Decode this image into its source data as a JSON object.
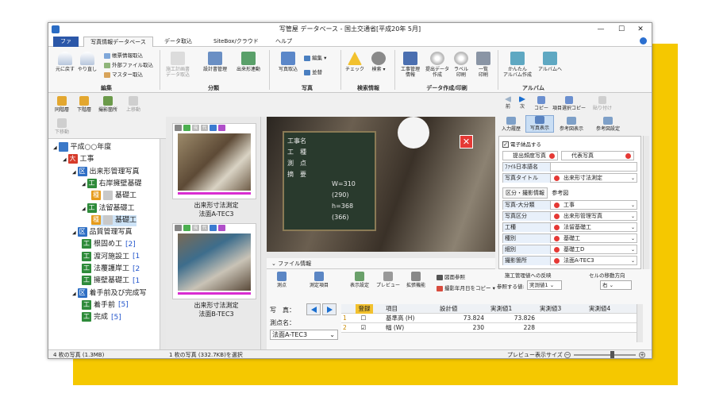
{
  "window": {
    "title": "写管屋 データベース - 国土交通省[平成20年 5月]",
    "minimize": "—",
    "maximize": "☐",
    "close": "✕"
  },
  "menu": {
    "file": "ファイル",
    "tabs": [
      "写真情報データベース",
      "データ取込",
      "SiteBox/クラウド",
      "ヘルプ"
    ]
  },
  "ribbon": {
    "undo": "元に戻す",
    "redo": "やり直し",
    "small_items": [
      "帳票情報取込",
      "外部ファイル取込",
      "マスター取込"
    ],
    "group_edit": "編集",
    "plan_doc": "施工計画書\nデータ取込",
    "design": "設計書管理",
    "output_form": "出来形連動",
    "group_class": "分類",
    "photo_import": "写真取込",
    "edit": "編集",
    "sort": "並替",
    "group_photo": "写真",
    "check": "チェック",
    "search": "検索",
    "group_search": "検索情報",
    "const_info": "工事管理\n情報",
    "submit_data": "提出データ\n作成",
    "label_print": "ラベル\n印刷",
    "list_print": "一覧\n印刷",
    "group_print": "データ作成/印刷",
    "easy_album": "かんたん\nアルバム作成",
    "album": "アルバムへ",
    "group_album": "アルバム"
  },
  "nav_tools": {
    "same_level": "同階層",
    "lower": "下階層",
    "shooting_place": "撮影箇所",
    "up": "上移動",
    "down": "下移動"
  },
  "tree": [
    {
      "label": "平成○○年度",
      "badge": "",
      "color": "#3a78c8",
      "indent": 0
    },
    {
      "label": "工事",
      "badge": "大",
      "color": "#d63b2b",
      "indent": 1
    },
    {
      "label": "出来形管理写真",
      "badge": "区",
      "color": "#2f6fc4",
      "indent": 2
    },
    {
      "label": "右岸擁壁基礎",
      "badge": "工",
      "color": "#2e8b3a",
      "indent": 3
    },
    {
      "label": "基礎工",
      "badge": "種",
      "color": "#e69b1b",
      "indent": 4
    },
    {
      "label": "法留基礎工",
      "badge": "工",
      "color": "#2e8b3a",
      "indent": 3
    },
    {
      "label": "基礎工",
      "badge": "種",
      "color": "#e69b1b",
      "indent": 4
    },
    {
      "label": "品質管理写真",
      "badge": "区",
      "color": "#2f6fc4",
      "indent": 2
    },
    {
      "label": "根固め工",
      "badge": "工",
      "color": "#2e8b3a",
      "indent": 3,
      "count": "[2]"
    },
    {
      "label": "渡河施設工",
      "badge": "工",
      "color": "#2e8b3a",
      "indent": 3,
      "count": "[1"
    },
    {
      "label": "法覆護岸工",
      "badge": "工",
      "color": "#2e8b3a",
      "indent": 3,
      "count": "[2"
    },
    {
      "label": "擁壁基礎工",
      "badge": "工",
      "color": "#2e8b3a",
      "indent": 3,
      "count": "[1"
    },
    {
      "label": "着手前及び完成写",
      "badge": "区",
      "color": "#2f6fc4",
      "indent": 2
    },
    {
      "label": "着手前",
      "badge": "工",
      "color": "#2e8b3a",
      "indent": 3,
      "count": "[5]"
    },
    {
      "label": "完成",
      "badge": "工",
      "color": "#2e8b3a",
      "indent": 3,
      "count": "[5]"
    }
  ],
  "thumbs": [
    {
      "cap1": "出来形寸法測定",
      "cap2": "法面A-TEC3"
    },
    {
      "cap1": "出来形寸法測定",
      "cap2": "法面B-TEC3"
    }
  ],
  "thumb_tags": [
    "提",
    "代"
  ],
  "preview": {
    "board_lines": [
      "工事名",
      "工　種",
      "測　点",
      "摘　要"
    ],
    "board_notes": [
      "W=310",
      "(290)",
      "h=368",
      "(366)"
    ],
    "fileinfo": "ファイル情報"
  },
  "right": {
    "nav": [
      "前",
      "次",
      "コピー",
      "項目選択コピー",
      "貼り付け"
    ],
    "tabs": [
      "入力履歴",
      "写真表示",
      "参考図表示",
      "参考図設定"
    ],
    "elec": "電子納品する",
    "submit": "提出頻度写真",
    "rep": "代表写真",
    "jp_name": "ﾌｧｲﾙ日本語名",
    "photo_title": "写真タイトル",
    "photo_title_val": "出来形寸法測定",
    "subtabs": [
      "区分・撮影情報",
      "参考図"
    ],
    "props": [
      {
        "k": "写真-大分類",
        "v": "工事"
      },
      {
        "k": "写真区分",
        "v": "出来形管理写真"
      },
      {
        "k": "工種",
        "v": "法留基礎工"
      },
      {
        "k": "種別",
        "v": "基礎工"
      },
      {
        "k": "細別",
        "v": "基礎工D"
      },
      {
        "k": "撮影箇所",
        "v": "法面A-TEC3"
      }
    ]
  },
  "bottom": {
    "tools": [
      "測点",
      "測定項目",
      "表示設定",
      "プレビュー",
      "拡張機能"
    ],
    "fig_ref": "図面参照",
    "copy_date": "撮影年月日をコピー",
    "reflect": "施工管理値への反映",
    "ref_val": "参照する値:",
    "ref_sel": "実測値1",
    "move_dir": "セルの移動方向",
    "move_sel": "右",
    "photo_label": "写　真：",
    "point_label": "測点名：",
    "point_val": "法面A-TEC3",
    "cols": [
      "登録",
      "項目",
      "設計値",
      "実測値1",
      "実測値3",
      "実測値4"
    ],
    "rows": [
      {
        "no": "1",
        "item": "基準高 (H)",
        "design": "73.824",
        "m1": "73.826",
        "reg": false
      },
      {
        "no": "2",
        "item": "幅 (W)",
        "design": "230",
        "m1": "228",
        "reg": true
      }
    ]
  },
  "status": {
    "left": "4 枚の写真 (1.3MB)",
    "mid": "1 枚の写真 (332.7KB)を選択",
    "right": "プレビュー表示サイズ"
  }
}
